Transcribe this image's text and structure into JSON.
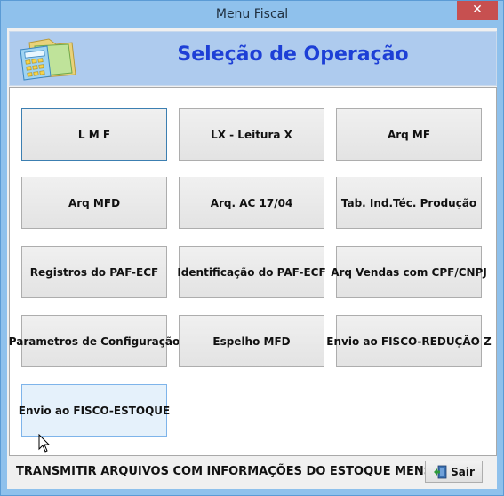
{
  "window": {
    "title": "Menu Fiscal",
    "close_glyph": "✕"
  },
  "header": {
    "title": "Seleção de Operação",
    "icon": "calculator-folder-icon"
  },
  "buttons": [
    "L M F",
    "LX - Leitura X",
    "Arq MF",
    "Arq MFD",
    "Arq. AC 17/04",
    "Tab. Ind.Téc. Produção",
    "Registros do PAF-ECF",
    "Identificação do PAF-ECF",
    "Arq Vendas com CPF/CNPJ",
    "Parametros de Configuração",
    "Espelho MFD",
    "Envio ao FISCO-REDUÇÃO Z",
    "Envio ao FISCO-ESTOQUE"
  ],
  "status": {
    "text": "TRANSMITIR ARQUIVOS COM INFORMAÇÕES DO ESTOQUE MENSAL",
    "exit_label": "Sair",
    "exit_icon": "exit-door-icon"
  },
  "colors": {
    "title_blue": "#1d3fd6",
    "titlebar": "#8fc1ec",
    "header_panel": "#aecbee",
    "close": "#c75050"
  }
}
